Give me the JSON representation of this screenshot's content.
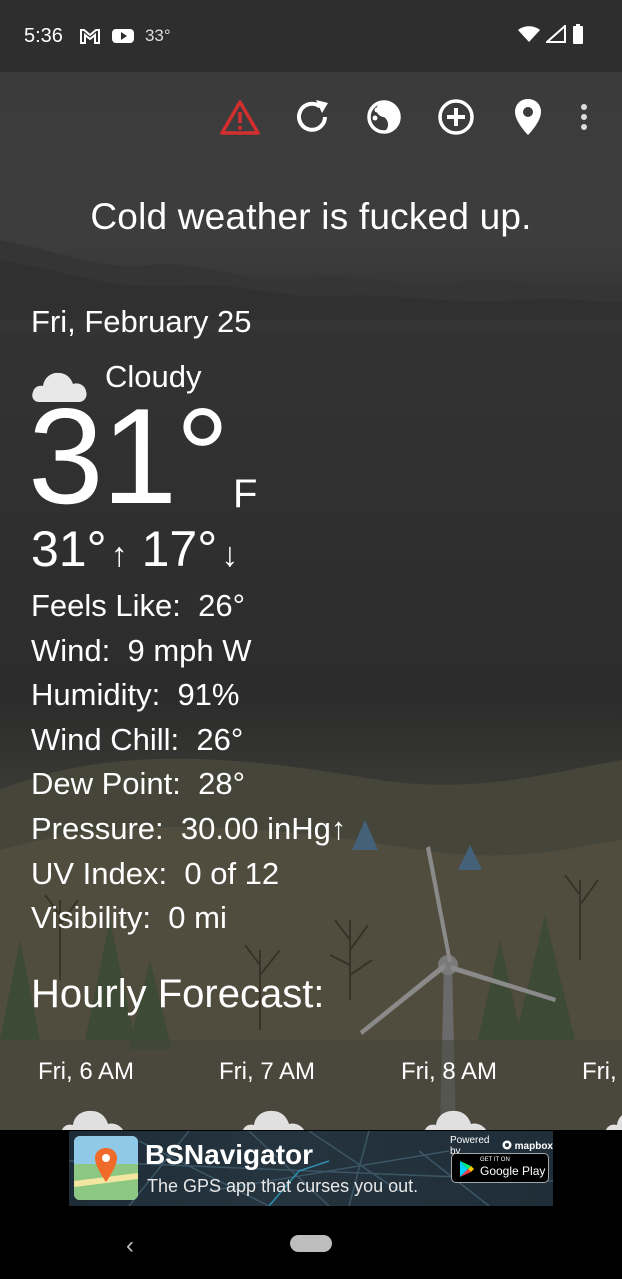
{
  "status_bar": {
    "time": "5:36",
    "temperature": "33°",
    "icons": [
      "gmail-icon",
      "youtube-icon",
      "wifi-icon",
      "signal-icon",
      "battery-icon"
    ]
  },
  "toolbar": {
    "icons": [
      "alert-icon",
      "refresh-icon",
      "theme-icon",
      "add-location-icon",
      "location-pin-icon",
      "more-menu-icon"
    ],
    "alert_color": "#d32f2f"
  },
  "snark": "Cold weather is fucked up.",
  "current": {
    "date": "Fri, February 25",
    "condition": "Cloudy",
    "condition_icon": "cloud-icon",
    "temperature": "31°",
    "unit": "F",
    "high": "31°",
    "high_arrow": "↑",
    "low": "17°",
    "low_arrow": "↓"
  },
  "details": [
    {
      "label": "Feels Like:",
      "value": "26°"
    },
    {
      "label": "Wind:",
      "value": "9 mph W"
    },
    {
      "label": "Humidity:",
      "value": "91%"
    },
    {
      "label": "Wind Chill:",
      "value": "26°"
    },
    {
      "label": "Dew Point:",
      "value": "28°"
    },
    {
      "label": "Pressure:",
      "value": "30.00 inHg↑"
    },
    {
      "label": "UV Index:",
      "value": "0 of 12"
    },
    {
      "label": "Visibility:",
      "value": "0 mi"
    }
  ],
  "hourly": {
    "title": "Hourly Forecast:",
    "hours": [
      {
        "label": "Fri, 6 AM"
      },
      {
        "label": "Fri, 7 AM"
      },
      {
        "label": "Fri, 8 AM"
      },
      {
        "label": "Fri,"
      }
    ]
  },
  "ad": {
    "title": "BSNavigator",
    "subtitle": "The GPS app that curses you out.",
    "powered_by": "Powered by",
    "mapbox": "mapbox",
    "store_small": "GET IT ON",
    "store_big": "Google Play"
  },
  "nav": {
    "back": "‹"
  }
}
